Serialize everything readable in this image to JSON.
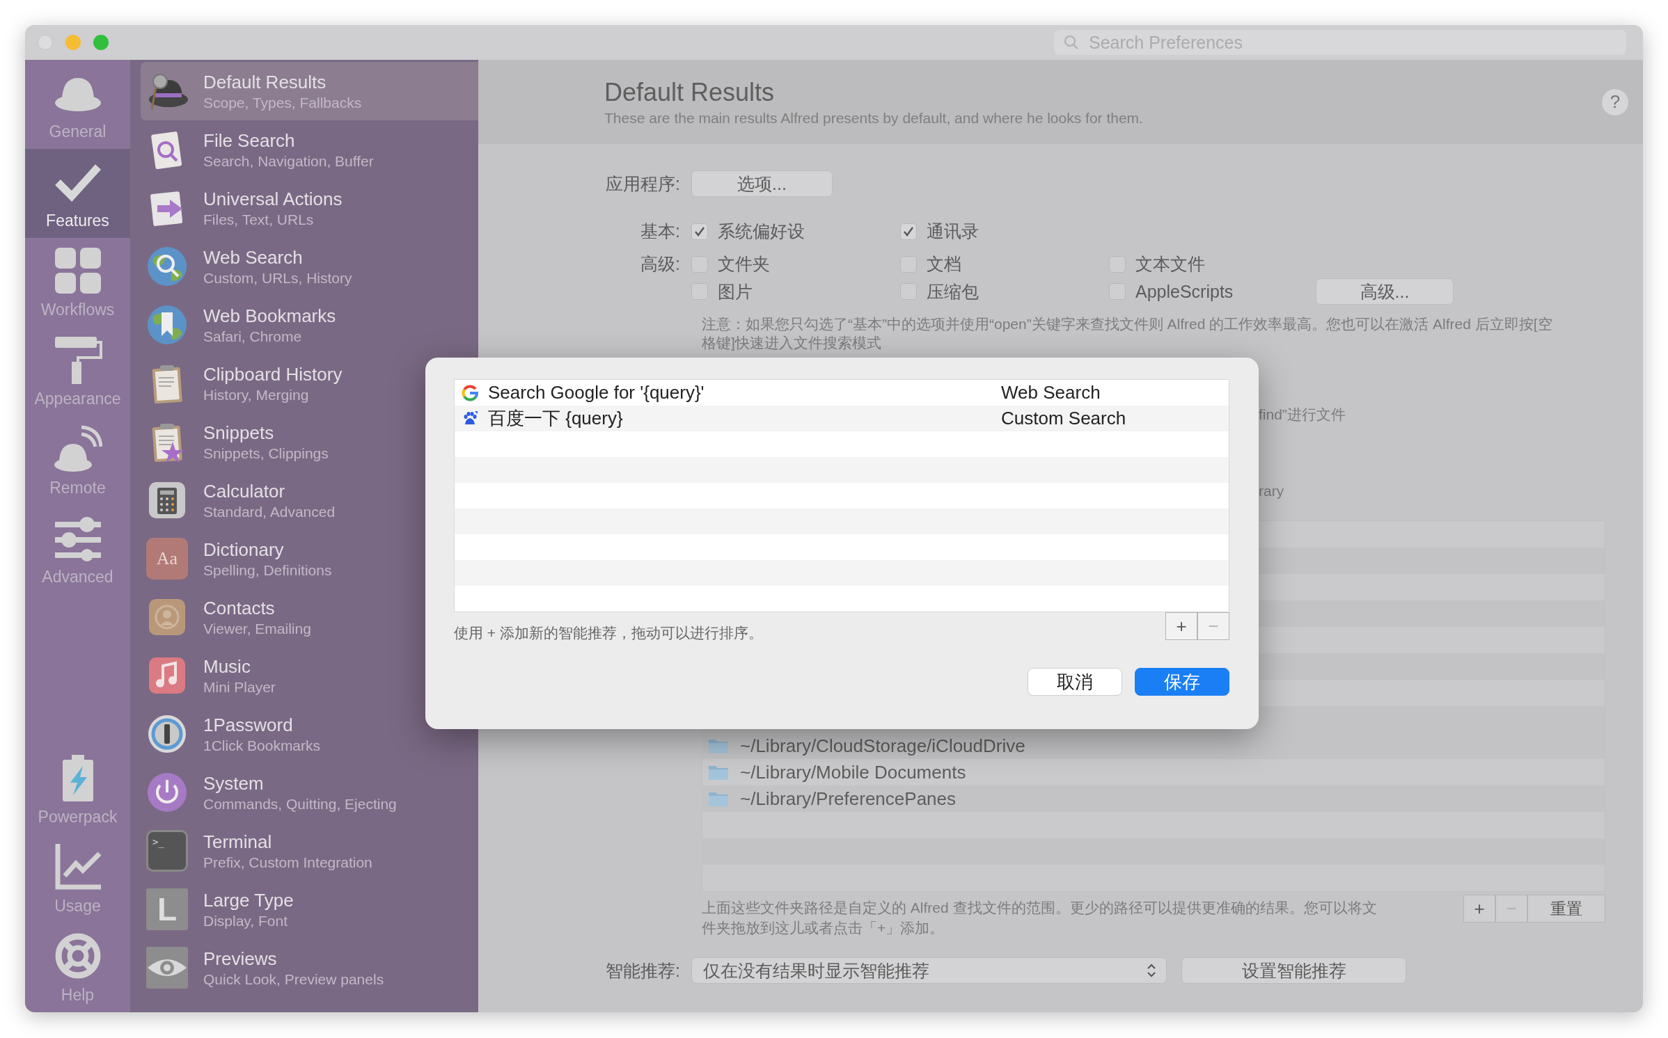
{
  "window": {
    "search": {
      "placeholder": "Search Preferences"
    }
  },
  "nav": [
    {
      "label": "General",
      "selected": false
    },
    {
      "label": "Features",
      "selected": true
    },
    {
      "label": "Workflows",
      "selected": false
    },
    {
      "label": "Appearance",
      "selected": false
    },
    {
      "label": "Remote",
      "selected": false
    },
    {
      "label": "Advanced",
      "selected": false
    },
    {
      "label": "Powerpack",
      "selected": false
    },
    {
      "label": "Usage",
      "selected": false
    },
    {
      "label": "Help",
      "selected": false
    }
  ],
  "features": [
    {
      "title": "Default Results",
      "subtitle": "Scope, Types, Fallbacks",
      "selected": true
    },
    {
      "title": "File Search",
      "subtitle": "Search, Navigation, Buffer",
      "selected": false
    },
    {
      "title": "Universal Actions",
      "subtitle": "Files, Text, URLs",
      "selected": false
    },
    {
      "title": "Web Search",
      "subtitle": "Custom, URLs, History",
      "selected": false
    },
    {
      "title": "Web Bookmarks",
      "subtitle": "Safari, Chrome",
      "selected": false
    },
    {
      "title": "Clipboard History",
      "subtitle": "History, Merging",
      "selected": false
    },
    {
      "title": "Snippets",
      "subtitle": "Snippets, Clippings",
      "selected": false
    },
    {
      "title": "Calculator",
      "subtitle": "Standard, Advanced",
      "selected": false
    },
    {
      "title": "Dictionary",
      "subtitle": "Spelling, Definitions",
      "glyph": "Aa",
      "selected": false
    },
    {
      "title": "Contacts",
      "subtitle": "Viewer, Emailing",
      "selected": false
    },
    {
      "title": "Music",
      "subtitle": "Mini Player",
      "selected": false
    },
    {
      "title": "1Password",
      "subtitle": "1Click Bookmarks",
      "selected": false
    },
    {
      "title": "System",
      "subtitle": "Commands, Quitting, Ejecting",
      "selected": false
    },
    {
      "title": "Terminal",
      "subtitle": "Prefix, Custom Integration",
      "glyph": ">_",
      "selected": false
    },
    {
      "title": "Large Type",
      "subtitle": "Display, Font",
      "glyph": "L",
      "selected": false
    },
    {
      "title": "Previews",
      "subtitle": "Quick Look, Preview panels",
      "selected": false
    }
  ],
  "header": {
    "title": "Default Results",
    "subtitle": "These are the main results Alfred presents by default, and where he looks for them.",
    "help": "?"
  },
  "apps": {
    "label": "应用程序:",
    "button": "选项..."
  },
  "basic": {
    "label": "基本:",
    "items": [
      {
        "label": "系统偏好设",
        "checked": true
      },
      {
        "label": "通讯录",
        "checked": true
      }
    ]
  },
  "advanced": {
    "label": "高级:",
    "items": [
      {
        "label": "文件夹",
        "checked": false
      },
      {
        "label": "文档",
        "checked": false
      },
      {
        "label": "文本文件",
        "checked": false
      },
      {
        "label": "图片",
        "checked": false
      },
      {
        "label": "压缩包",
        "checked": false
      },
      {
        "label": "AppleScripts",
        "checked": false
      }
    ],
    "button": "高级..."
  },
  "note": "注意：如果您只勾选了“基本”中的选项并使用“open”关键字来查找文件则 Alfred 的工作效率最高。您也可以在激活 Alfred 后立即按[空格键]快速进入文件搜索模式",
  "fragments": [
    "find”进行文件",
    "rary"
  ],
  "scope": {
    "paths": [
      "~/Library/CloudStorage/iCloudDrive",
      "~/Library/Mobile Documents",
      "~/Library/PreferencePanes"
    ],
    "add": "+",
    "remove": {
      "label": "−",
      "disabled": true
    },
    "reset": "重置",
    "note": "上面这些文件夹路径是自定义的 Alfred 查找文件的范围。更少的路径可以提供更准确的结果。您可以将文件夹拖放到这儿或者点击「+」添加。"
  },
  "fallback": {
    "label": "智能推荐:",
    "value": "仅在没有结果时显示智能推荐",
    "button": "设置智能推荐"
  },
  "dialog": {
    "rows": [
      {
        "name": "Search Google for '{query}'",
        "type": "Web Search",
        "selected": false
      },
      {
        "name": "百度一下 {query}",
        "type": "Custom Search",
        "selected": false
      }
    ],
    "hint": "使用 + 添加新的智能推荐，拖动可以进行排序。",
    "add": "+",
    "remove": {
      "label": "−",
      "disabled": true
    },
    "cancel": "取消",
    "save": "保存"
  }
}
